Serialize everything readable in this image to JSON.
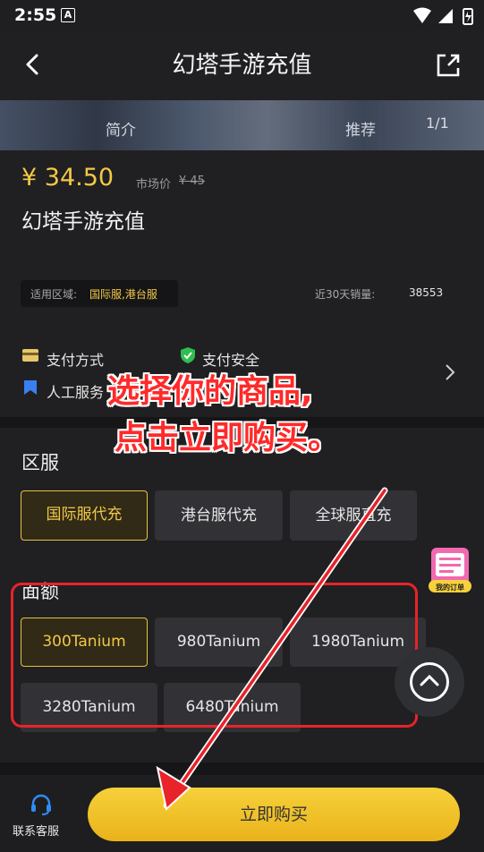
{
  "status_bar": {
    "time": "2:55",
    "a_badge": "A"
  },
  "header": {
    "title": "幻塔手游充值"
  },
  "banner": {
    "tab_intro": "简介",
    "tab_recommend": "推荐",
    "pager": "1/1"
  },
  "product": {
    "price": "¥ 34.50",
    "market_price_label": "市场价",
    "market_price_value": "¥ 45",
    "name": "幻塔手游充值",
    "region_label": "适用区域:",
    "region_value": "国际服,港台服",
    "sales_label": "近30天销量:",
    "sales_value": "38553"
  },
  "features": {
    "payment_method": "支付方式",
    "payment_security": "支付安全",
    "manual_service": "人工服务"
  },
  "server_section": {
    "title": "区服",
    "options": [
      "国际服代充",
      "港台服代充",
      "全球服直充"
    ],
    "selected_index": 0
  },
  "amount_section": {
    "title": "面额",
    "options": [
      "300Tanium",
      "980Tanium",
      "1980Tanium",
      "3280Tanium",
      "6480Tanium"
    ],
    "selected_index": 0
  },
  "annotation": {
    "line1": "选择你的商品,",
    "line2": "点击立即购买。"
  },
  "floating": {
    "my_orders": "我的订单"
  },
  "bottom_bar": {
    "customer_service": "联系客服",
    "buy_now": "立即购买"
  },
  "colors": {
    "accent": "#f3c846",
    "annotation_red": "#e8232a",
    "background": "#202022"
  }
}
